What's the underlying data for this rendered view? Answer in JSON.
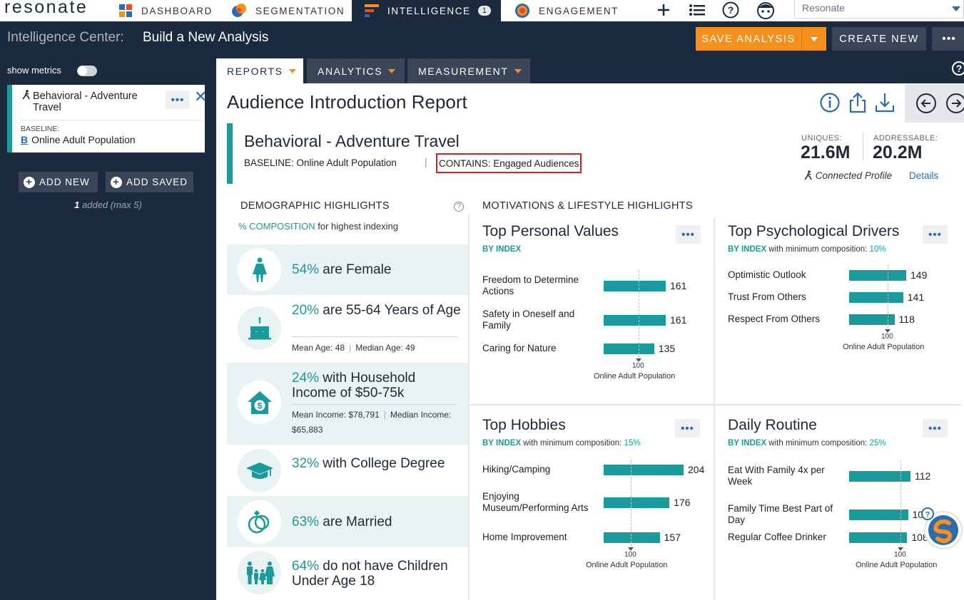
{
  "app": {
    "logo": "resonate",
    "nav_tabs": [
      {
        "label": "DASHBOARD"
      },
      {
        "label": "SEGMENTATION"
      },
      {
        "label": "INTELLIGENCE",
        "badge": "1"
      },
      {
        "label": "ENGAGEMENT"
      }
    ],
    "account_select": "Resonate"
  },
  "header": {
    "label": "Intelligence Center:",
    "title": "Build a New Analysis",
    "save_label": "SAVE ANALYSIS",
    "create_label": "CREATE NEW",
    "more_label": "•••"
  },
  "sidebar": {
    "show_metrics": "show metrics",
    "audience": {
      "name": "Behavioral - Adventure Travel",
      "baseline_label": "BASELINE:",
      "baseline_letter": "B",
      "baseline_value": "Online Adult Population"
    },
    "add_new": "ADD NEW",
    "add_saved": "ADD SAVED",
    "added_count": "1",
    "added_text": " added (max 5)"
  },
  "subnav": {
    "tabs": [
      {
        "label": "REPORTS"
      },
      {
        "label": "ANALYTICS"
      },
      {
        "label": "MEASUREMENT"
      }
    ]
  },
  "report": {
    "title": "Audience Introduction Report",
    "audience_title": "Behavioral - Adventure Travel",
    "baseline": "BASELINE: Online Adult Population",
    "contains": "CONTAINS: Engaged Audiences",
    "uniques_label": "UNIQUES:",
    "uniques_value": "21.6M",
    "addressable_label": "ADDRESSABLE:",
    "addressable_value": "20.2M",
    "connected_profile": "Connected Profile",
    "details_link": "Details"
  },
  "demographics": {
    "heading": "DEMOGRAPHIC HIGHLIGHTS",
    "sub_highlight": "% COMPOSITION",
    "sub_rest": " for highest indexing",
    "rows": [
      {
        "pct": "54%",
        "text": " are Female",
        "icon": "female-icon"
      },
      {
        "pct": "20%",
        "text": " are 55-64 Years of Age",
        "stat1": "Mean Age: 48",
        "stat2": "Median Age: 49",
        "icon": "cake-icon"
      },
      {
        "pct": "24%",
        "text": " with Household Income of $50-75k",
        "stat1": "Mean Income: $78,791",
        "stat2": "Median Income: $65,883",
        "icon": "house-dollar-icon"
      },
      {
        "pct": "32%",
        "text": " with College Degree",
        "icon": "graduation-cap-icon"
      },
      {
        "pct": "63%",
        "text": " are Married",
        "icon": "rings-icon"
      },
      {
        "pct": "64%",
        "text": " do not have Children Under Age 18",
        "icon": "family-icon"
      }
    ]
  },
  "motivations": {
    "heading": "MOTIVATIONS & LIFESTYLE HIGHLIGHTS",
    "reference_value": "100",
    "reference_label": "Online Adult Population",
    "panels": [
      {
        "title": "Top Personal Values",
        "sub_by": "BY INDEX",
        "sub_rest": "",
        "sub_value": "",
        "items": [
          {
            "label": "Freedom to Determine Actions",
            "value": 161
          },
          {
            "label": "Safety in Oneself and Family",
            "value": 161
          },
          {
            "label": "Caring for Nature",
            "value": 135
          }
        ]
      },
      {
        "title": "Top Psychological Drivers",
        "sub_by": "BY INDEX",
        "sub_rest": " with minimum composition: ",
        "sub_value": "10%",
        "items": [
          {
            "label": "Optimistic Outlook",
            "value": 149
          },
          {
            "label": "Trust From Others",
            "value": 141
          },
          {
            "label": "Respect From Others",
            "value": 118
          }
        ]
      },
      {
        "title": "Top Hobbies",
        "sub_by": "BY INDEX",
        "sub_rest": " with minimum composition: ",
        "sub_value": "15%",
        "items": [
          {
            "label": "Hiking/Camping",
            "value": 204
          },
          {
            "label": "Enjoying Museum/Performing Arts",
            "value": 176
          },
          {
            "label": "Home Improvement",
            "value": 157
          }
        ]
      },
      {
        "title": "Daily Routine",
        "sub_by": "BY INDEX",
        "sub_rest": " with minimum composition: ",
        "sub_value": "25%",
        "items": [
          {
            "label": "Eat With Family 4x per Week",
            "value": 112
          },
          {
            "label": "Family Time Best Part of Day",
            "value": 109
          },
          {
            "label": "Regular Coffee Drinker",
            "value": 108
          }
        ]
      }
    ]
  },
  "colors": {
    "navy": "#1c2a3d",
    "teal": "#1a9a9a",
    "orange": "#f5901e",
    "link_blue": "#2b6cb0"
  }
}
